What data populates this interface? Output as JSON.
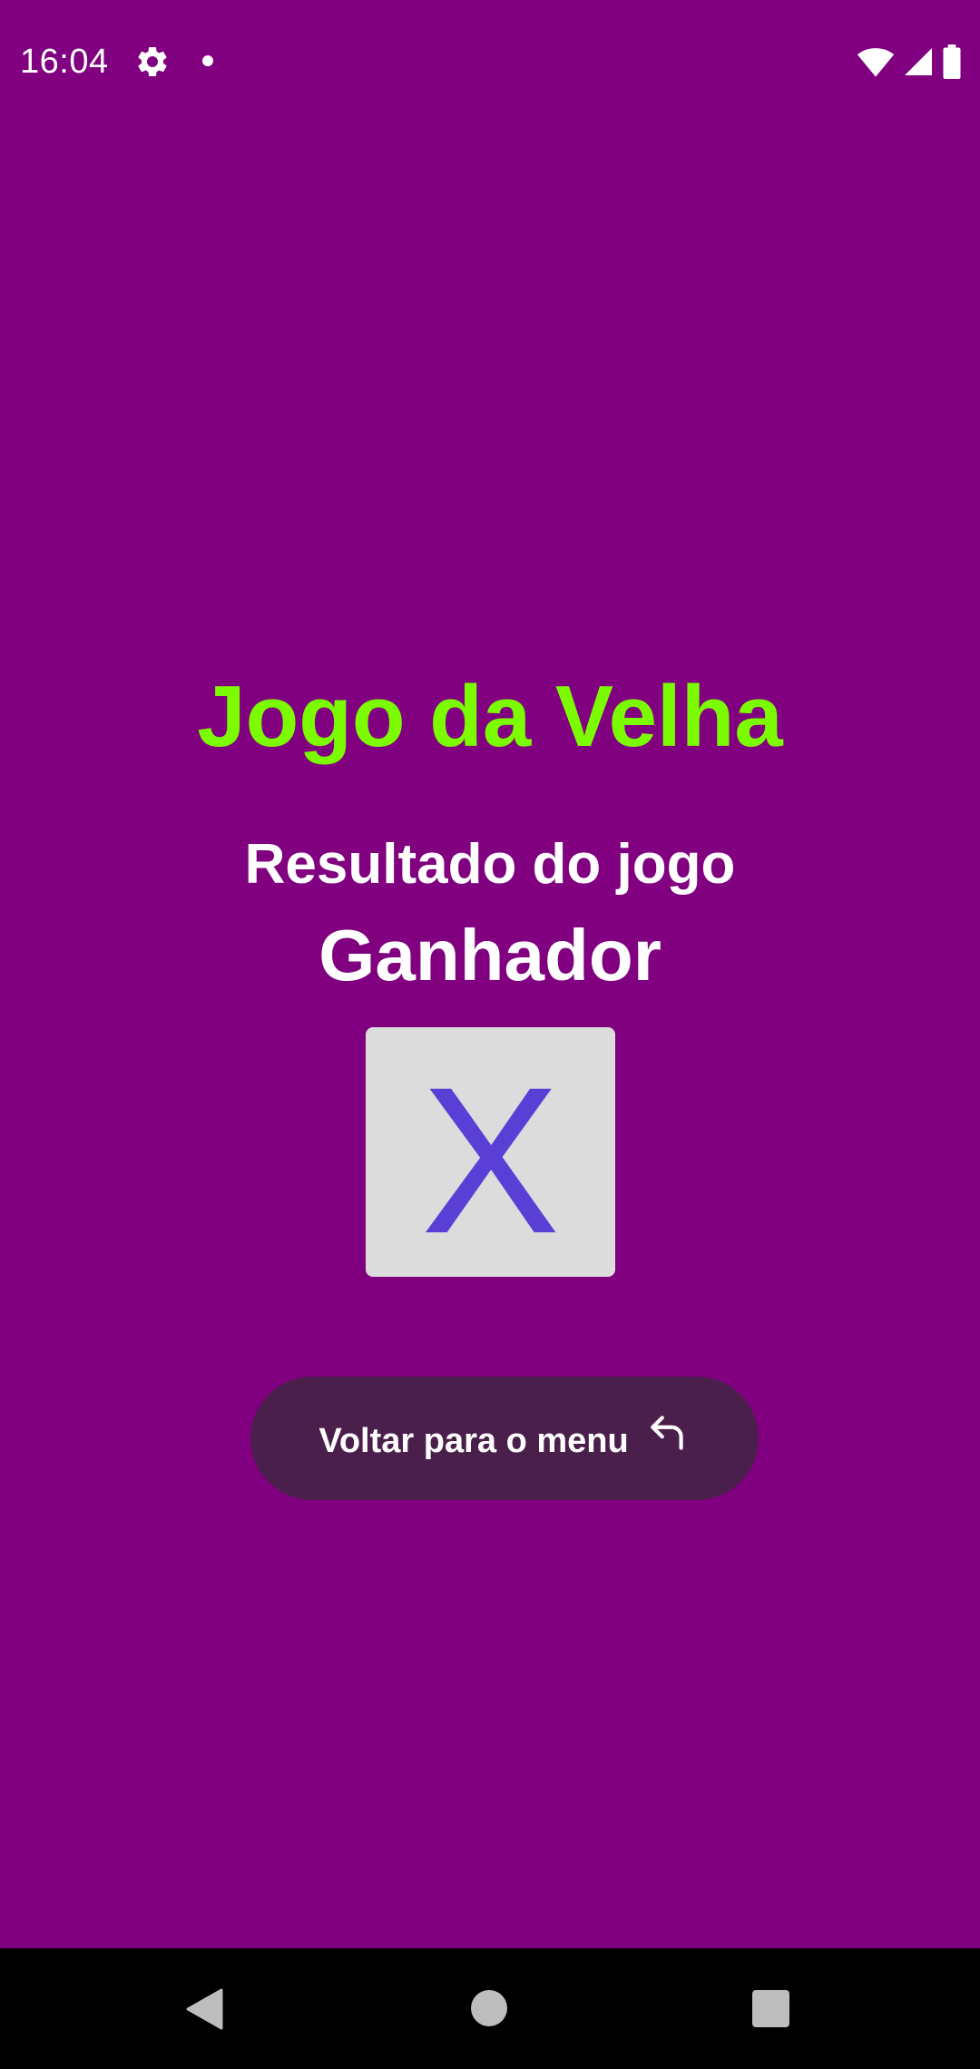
{
  "status_bar": {
    "time": "16:04",
    "icons": [
      "gear-icon",
      "notification-dot-icon",
      "wifi-icon",
      "signal-icon",
      "battery-icon"
    ]
  },
  "game": {
    "title": "Jogo da Velha",
    "result_label": "Resultado do jogo",
    "winner_label": "Ganhador",
    "winner_symbol": "X"
  },
  "actions": {
    "back_to_menu_label": "Voltar para o menu",
    "back_to_menu_icon": "undo-arrow-icon"
  },
  "nav_bar": {
    "buttons": [
      "back-icon",
      "home-icon",
      "recents-icon"
    ]
  },
  "colors": {
    "background": "#800080",
    "title": "#7CFC00",
    "text": "#ffffff",
    "tile": "#dcdcdc",
    "symbol": "#5a3fd6",
    "button": "#4b1f4b",
    "nav_bar": "#000000"
  }
}
